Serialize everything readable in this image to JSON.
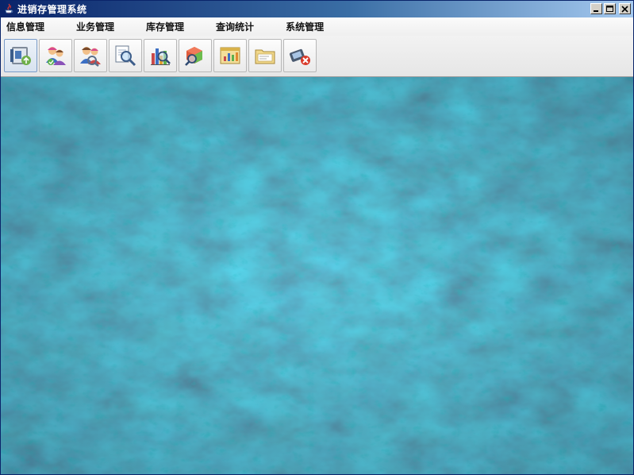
{
  "window": {
    "title": "进销存管理系统",
    "minimize_label": "_",
    "maximize_label": "□",
    "close_label": "✕"
  },
  "menubar": {
    "items": [
      {
        "label": "信息管理"
      },
      {
        "label": "业务管理"
      },
      {
        "label": "库存管理"
      },
      {
        "label": "查询统计"
      },
      {
        "label": "系统管理"
      }
    ]
  },
  "toolbar": {
    "buttons": [
      {
        "icon": "info-manage-icon"
      },
      {
        "icon": "customer-info-icon"
      },
      {
        "icon": "supplier-info-icon"
      },
      {
        "icon": "query-icon"
      },
      {
        "icon": "stock-chart-icon"
      },
      {
        "icon": "stock-search-icon"
      },
      {
        "icon": "report-icon"
      },
      {
        "icon": "folder-icon"
      },
      {
        "icon": "exit-icon"
      }
    ]
  },
  "colors": {
    "title_bar_start": "#0a246a",
    "title_bar_end": "#a6caf0",
    "desktop_background": "#1f4560"
  }
}
